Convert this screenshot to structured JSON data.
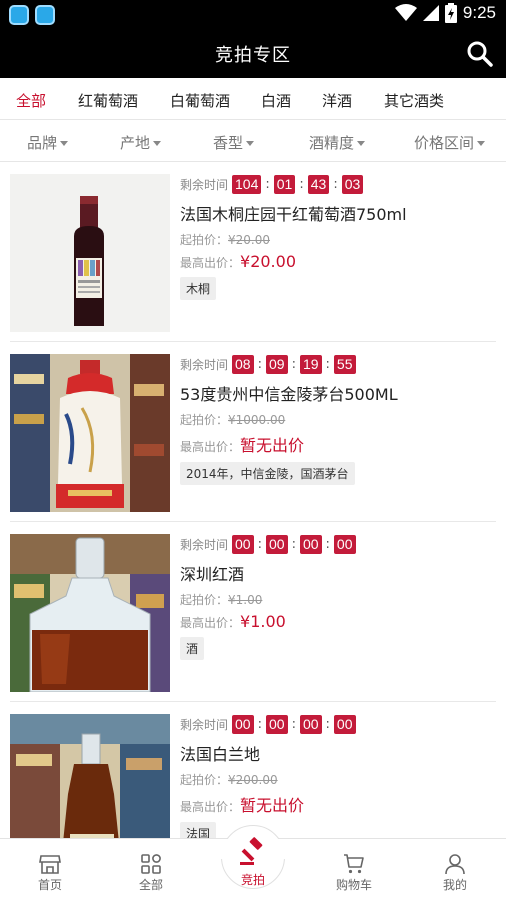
{
  "status": {
    "time": "9:25"
  },
  "header": {
    "title": "竞拍专区"
  },
  "categories": [
    {
      "label": "全部",
      "active": true
    },
    {
      "label": "红葡萄酒"
    },
    {
      "label": "白葡萄酒"
    },
    {
      "label": "白酒"
    },
    {
      "label": "洋酒"
    },
    {
      "label": "其它酒类"
    }
  ],
  "filters": [
    "品牌",
    "产地",
    "香型",
    "酒精度",
    "价格区间"
  ],
  "labels": {
    "remaining": "剩余时间",
    "start_price": "起拍价：",
    "highest_bid": "最高出价："
  },
  "items": [
    {
      "timer": [
        "104",
        "01",
        "43",
        "03"
      ],
      "name": "法国木桐庄园干红葡萄酒750ml",
      "start_price": "¥20.00",
      "highest_bid": "¥20.00",
      "tag": "木桐",
      "image": "red-wine-bottle"
    },
    {
      "timer": [
        "08",
        "09",
        "19",
        "55"
      ],
      "name": "53度贵州中信金陵茅台500ML",
      "start_price": "¥1000.00",
      "highest_bid": "暂无出价",
      "tag": "2014年，中信金陵，国酒茅台",
      "image": "moutai-bottle"
    },
    {
      "timer": [
        "00",
        "00",
        "00",
        "00"
      ],
      "name": "深圳红酒",
      "start_price": "¥1.00",
      "highest_bid": "¥1.00",
      "tag": "酒",
      "image": "decanter-bottle"
    },
    {
      "timer": [
        "00",
        "00",
        "00",
        "00"
      ],
      "name": "法国白兰地",
      "start_price": "¥200.00",
      "highest_bid": "暂无出价",
      "tag": "法国",
      "image": "brandy-bottle"
    }
  ],
  "tabs": [
    {
      "label": "首页",
      "icon": "store-icon"
    },
    {
      "label": "全部",
      "icon": "grid-icon"
    },
    {
      "label": "竞拍",
      "icon": "gavel-icon",
      "active": true
    },
    {
      "label": "购物车",
      "icon": "cart-icon"
    },
    {
      "label": "我的",
      "icon": "user-icon"
    }
  ],
  "colors": {
    "accent": "#c8102e",
    "timer_bg": "#c31b3a",
    "header_bg": "#000000"
  }
}
